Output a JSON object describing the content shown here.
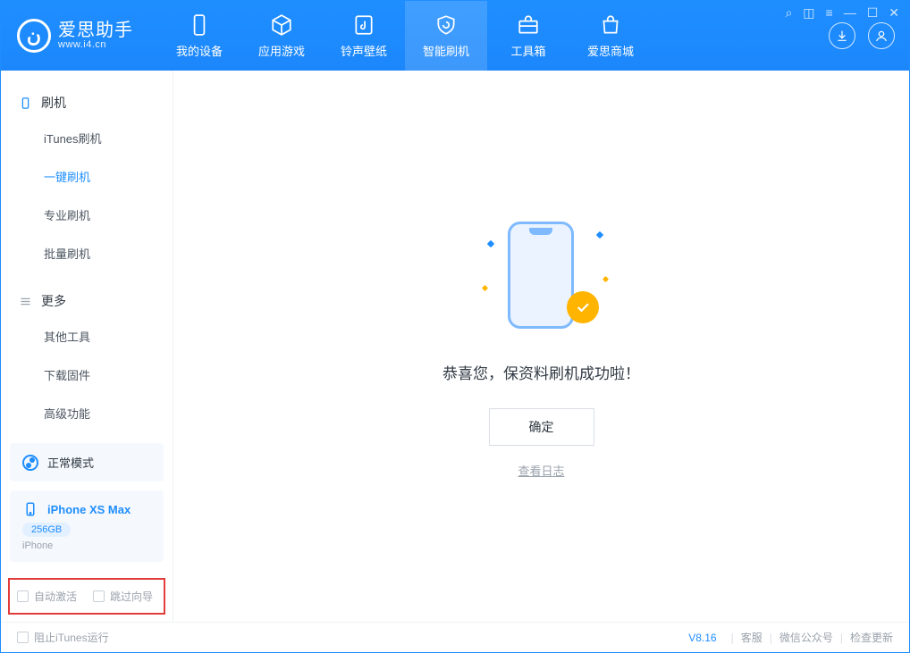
{
  "app": {
    "title": "爱思助手",
    "subtitle": "www.i4.cn"
  },
  "tabs": {
    "device": "我的设备",
    "apps": "应用游戏",
    "ringtones": "铃声壁纸",
    "flash": "智能刷机",
    "toolbox": "工具箱",
    "store": "爱思商城"
  },
  "sidebar": {
    "section_flash": "刷机",
    "items_flash": {
      "itunes": "iTunes刷机",
      "onekey": "一键刷机",
      "pro": "专业刷机",
      "batch": "批量刷机"
    },
    "section_more": "更多",
    "items_more": {
      "other": "其他工具",
      "firmware": "下载固件",
      "advanced": "高级功能"
    }
  },
  "mode": {
    "label": "正常模式"
  },
  "device": {
    "name": "iPhone XS Max",
    "storage": "256GB",
    "type": "iPhone"
  },
  "checks": {
    "auto_activate": "自动激活",
    "skip_guide": "跳过向导"
  },
  "main": {
    "success": "恭喜您，保资料刷机成功啦！",
    "ok": "确定",
    "view_log": "查看日志"
  },
  "status": {
    "block_itunes": "阻止iTunes运行",
    "version": "V8.16",
    "support": "客服",
    "wechat": "微信公众号",
    "update": "检查更新"
  }
}
